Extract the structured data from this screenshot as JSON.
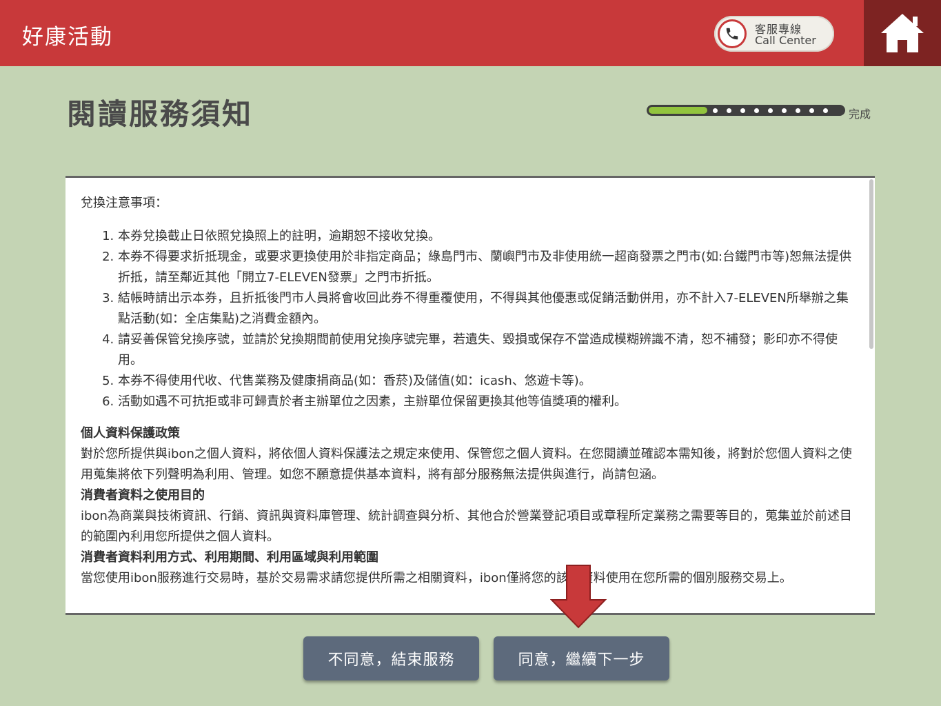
{
  "header": {
    "app_title": "好康活動",
    "call_center_line1": "客服專線",
    "call_center_line2": "Call Center"
  },
  "page": {
    "title": "閱讀服務須知",
    "progress_label": "完成",
    "progress_fraction": 0.3
  },
  "notice": {
    "heading": "兌換注意事項：",
    "rules": [
      "本券兌換截止日依照兌換照上的註明，逾期恕不接收兌換。",
      "本券不得要求折抵現金，或要求更換使用於非指定商品；綠島門市、蘭嶼門市及非使用統一超商發票之門市(如:台鐵門市等)恕無法提供折抵，請至鄰近其他「開立7-ELEVEN發票」之門市折抵。",
      "結帳時請出示本券，且折抵後門市人員將會收回此券不得重覆使用，不得與其他優惠或促銷活動併用，亦不計入7-ELEVEN所舉辦之集點活動(如：全店集點)之消費金額內。",
      "請妥善保管兌換序號，並請於兌換期間前使用兌換序號完畢，若遺失、毀損或保存不當造成模糊辨識不清，恕不補發；影印亦不得使用。",
      "本券不得使用代收、代售業務及健康捐商品(如：香菸)及儲值(如：icash、悠遊卡等)。",
      "活動如遇不可抗拒或非可歸責於者主辦單位之因素，主辦單位保留更換其他等值獎項的權利。"
    ],
    "privacy_title": "個人資料保護政策",
    "privacy_body": "對於您所提供與ibon之個人資料，將依個人資料保護法之規定來使用、保管您之個人資料。在您閱讀並確認本需知後，將對於您個人資料之使用蒐集將依下列聲明為利用、管理。如您不願意提供基本資料，將有部分服務無法提供與進行，尚請包涵。",
    "purpose_title": "消費者資料之使用目的",
    "purpose_body": "ibon為商業與技術資訊、行銷、資訊與資料庫管理、統計調查與分析、其他合於營業登記項目或章程所定業務之需要等目的，蒐集並於前述目的範圍內利用您所提供之個人資料。",
    "usage_title": "消費者資料利用方式、利用期間、利用區域與利用範圍",
    "usage_body": "當您使用ibon服務進行交易時，基於交易需求請您提供所需之相關資料，ibon僅將您的該些資料使用在您所需的個別服務交易上。"
  },
  "buttons": {
    "disagree": "不同意，結束服務",
    "agree": "同意，繼續下一步"
  },
  "colors": {
    "header_red": "#c8393a",
    "home_dark_red": "#7d2322",
    "background": "#c4d4b4",
    "button": "#5d6a7c",
    "progress_green": "#92c43e"
  }
}
